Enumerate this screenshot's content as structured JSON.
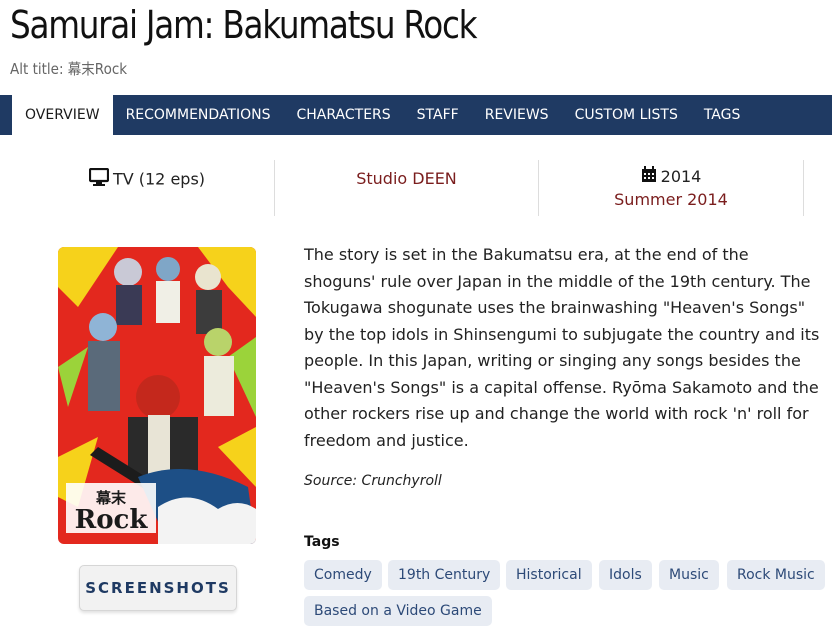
{
  "anime": {
    "title": "Samurai Jam: Bakumatsu Rock",
    "alt_title": "Alt title: 幕末Rock"
  },
  "tabs": [
    {
      "label": "OVERVIEW",
      "active": true
    },
    {
      "label": "RECOMMENDATIONS"
    },
    {
      "label": "CHARACTERS"
    },
    {
      "label": "STAFF"
    },
    {
      "label": "REVIEWS"
    },
    {
      "label": "CUSTOM LISTS"
    },
    {
      "label": "TAGS"
    }
  ],
  "info": {
    "format": {
      "icon": "tv-icon",
      "text": "TV (12 eps)"
    },
    "studio": "Studio DEEN",
    "year": {
      "icon": "calendar-icon",
      "text": "2014"
    },
    "season": "Summer 2014"
  },
  "poster": {
    "logo_text": "幕末 Rock"
  },
  "screenshots_label": "SCREENSHOTS",
  "synopsis": "The story is set in the Bakumatsu era, at the end of the shoguns' rule over Japan in the middle of the 19th century. The Tokugawa shogunate uses the brainwashing \"Heaven's Songs\" by the top idols in Shinsengumi to subjugate the country and its people. In this Japan, writing or singing any songs besides the \"Heaven's Songs\" is a capital offense. Ryōma Sakamoto and the other rockers rise up and change the world with rock 'n' roll for freedom and justice.",
  "source": "Source: Crunchyroll",
  "tags": {
    "heading": "Tags",
    "items": [
      "Comedy",
      "19th Century",
      "Historical",
      "Idols",
      "Music",
      "Rock Music",
      "Based on a Video Game"
    ]
  },
  "colors": {
    "nav_bg": "#1f3a63",
    "link_red": "#7a1d1d",
    "tag_bg": "#e8ecf3",
    "tag_text": "#2d4a78"
  }
}
